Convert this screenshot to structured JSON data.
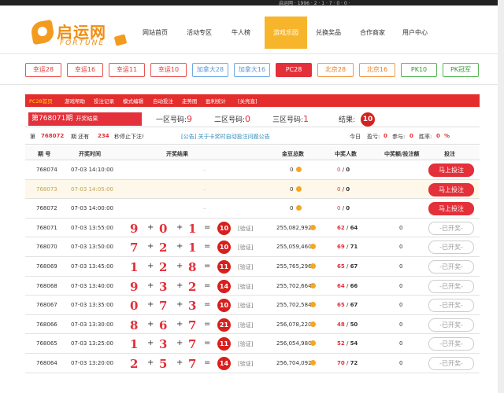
{
  "topbar": {
    "text": "启运网 · 1996 · 2 · 1 · 7 · 0 · 0 ·"
  },
  "logo": {
    "cn": "启运网",
    "en": "FORTUNE"
  },
  "nav": [
    {
      "label": "网站首页",
      "active": false
    },
    {
      "label": "活动专区",
      "active": false
    },
    {
      "label": "牛人榜",
      "active": false
    },
    {
      "label": "游戏乐园",
      "active": true
    },
    {
      "label": "兑换奖品",
      "active": false
    },
    {
      "label": "合作商家",
      "active": false
    },
    {
      "label": "用户中心",
      "active": false
    }
  ],
  "filters": [
    {
      "label": "幸运28",
      "style": "red"
    },
    {
      "label": "幸运16",
      "style": "red"
    },
    {
      "label": "幸运11",
      "style": "red"
    },
    {
      "label": "幸运10",
      "style": "red"
    },
    {
      "label": "加拿大28",
      "style": "blue"
    },
    {
      "label": "加拿大16",
      "style": "blue"
    },
    {
      "label": "PC28",
      "style": "active"
    },
    {
      "label": "北京28",
      "style": "orange"
    },
    {
      "label": "北京16",
      "style": "orange"
    },
    {
      "label": "PK10",
      "style": "green"
    },
    {
      "label": "PK冠军",
      "style": "green"
    }
  ],
  "subnav": [
    "PC28首页",
    "游戏帮助",
    "投注记录",
    "模式编辑",
    "自动投注",
    "走势图",
    "盈利统计",
    "[关亮直]"
  ],
  "draw": {
    "issue_label": "第768071期",
    "status": "开奖结果",
    "zone1_label": "一区号码:",
    "zone1": "9",
    "zone2_label": "二区号码:",
    "zone2": "0",
    "zone3_label": "三区号码:",
    "zone3": "1",
    "result_label": "结果:",
    "result": "10"
  },
  "status": {
    "prefix": "第",
    "issue": "768072",
    "mid": "期 还有",
    "seconds": "234",
    "suffix": "秒停止下注!",
    "notice": "[公告] 关于卡奖时自动投注问题公告",
    "today": "今日",
    "profit_label": "盈亏:",
    "profit": "0",
    "join_label": "参与:",
    "join": "0",
    "win_label": "胜率:",
    "win": "0",
    "win_unit": "%"
  },
  "table": {
    "headers": [
      "期 号",
      "开奖时间",
      "开奖结果",
      "金豆总数",
      "中奖人数",
      "中奖额/投注额",
      "投注"
    ],
    "bet_label": "马上投注",
    "opened_label": "-已开奖-",
    "verify_label": "[验证]",
    "ellipsis": "..",
    "rows": [
      {
        "issue": "768074",
        "time": "07-03 14:10:00",
        "pending": true,
        "total": "0",
        "winners": "0",
        "players": "0",
        "ratio": ""
      },
      {
        "issue": "768073",
        "time": "07-03 14:05:00",
        "pending": true,
        "total": "0",
        "winners": "0",
        "players": "0",
        "ratio": "",
        "hl": true
      },
      {
        "issue": "768072",
        "time": "07-03 14:00:00",
        "pending": true,
        "total": "0",
        "winners": "0",
        "players": "0",
        "ratio": ""
      },
      {
        "issue": "768071",
        "time": "07-03 13:55:00",
        "a": "9",
        "b": "0",
        "c": "1",
        "sum": "10",
        "total": "255,082,992",
        "winners": "62",
        "players": "64",
        "ratio": "0"
      },
      {
        "issue": "768070",
        "time": "07-03 13:50:00",
        "a": "7",
        "b": "2",
        "c": "1",
        "sum": "10",
        "total": "255,059,460",
        "winners": "69",
        "players": "71",
        "ratio": "0"
      },
      {
        "issue": "768069",
        "time": "07-03 13:45:00",
        "a": "1",
        "b": "2",
        "c": "8",
        "sum": "11",
        "total": "255,765,296",
        "winners": "65",
        "players": "67",
        "ratio": "0"
      },
      {
        "issue": "768068",
        "time": "07-03 13:40:00",
        "a": "9",
        "b": "3",
        "c": "2",
        "sum": "14",
        "total": "255,702,664",
        "winners": "64",
        "players": "66",
        "ratio": "0"
      },
      {
        "issue": "768067",
        "time": "07-03 13:35:00",
        "a": "0",
        "b": "7",
        "c": "3",
        "sum": "10",
        "total": "255,702,584",
        "winners": "65",
        "players": "67",
        "ratio": "0"
      },
      {
        "issue": "768066",
        "time": "07-03 13:30:00",
        "a": "8",
        "b": "6",
        "c": "7",
        "sum": "21",
        "total": "256,078,220",
        "winners": "48",
        "players": "50",
        "ratio": "0"
      },
      {
        "issue": "768065",
        "time": "07-03 13:25:00",
        "a": "1",
        "b": "3",
        "c": "7",
        "sum": "11",
        "total": "256,054,980",
        "winners": "52",
        "players": "54",
        "ratio": "0"
      },
      {
        "issue": "768064",
        "time": "07-03 13:20:00",
        "a": "2",
        "b": "5",
        "c": "7",
        "sum": "14",
        "total": "256,704,092",
        "winners": "70",
        "players": "72",
        "ratio": "0"
      }
    ]
  },
  "colors": {
    "accent": "#e3303a",
    "nav_active": "#f7b52c",
    "logo": "#f08e12"
  }
}
